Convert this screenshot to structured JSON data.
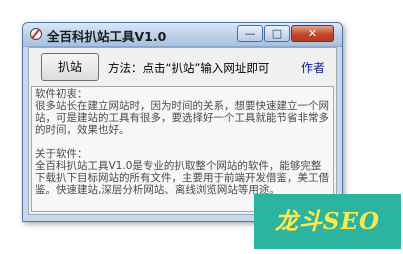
{
  "window": {
    "title": "全百科扒站工具V1.0",
    "controls": {
      "minimize": "—",
      "maximize": "□",
      "close": "✕"
    }
  },
  "toolbar": {
    "grab_button": "扒站",
    "method_text": "方法：点击“扒站”输入网址即可",
    "author_link": "作者"
  },
  "description": {
    "intro_heading": "软件初衷：",
    "intro_text": "很多站长在建立网站时，因为时间的关系，想要快速建立一个网站，可是建站的工具有很多，要选择好一个工具就能节省非常多的时间，效果也好。",
    "about_heading": "关于软件：",
    "about_text": "全百科扒站工具V1.0是专业的扒取整个网站的软件，能够完整下载扒下目标网站的所有文件，主要用于前端开发借鉴，美工借鉴。快速建站,深层分析网站、离线浏览网站等用途。"
  },
  "watermark": {
    "text": "龙斗SEO"
  },
  "colors": {
    "title_bar": "#b9cde6",
    "close_button": "#c2462b",
    "watermark_bg": "#2bb5a0",
    "watermark_text": "#ffe94a",
    "author_link": "#0a1a8c"
  }
}
